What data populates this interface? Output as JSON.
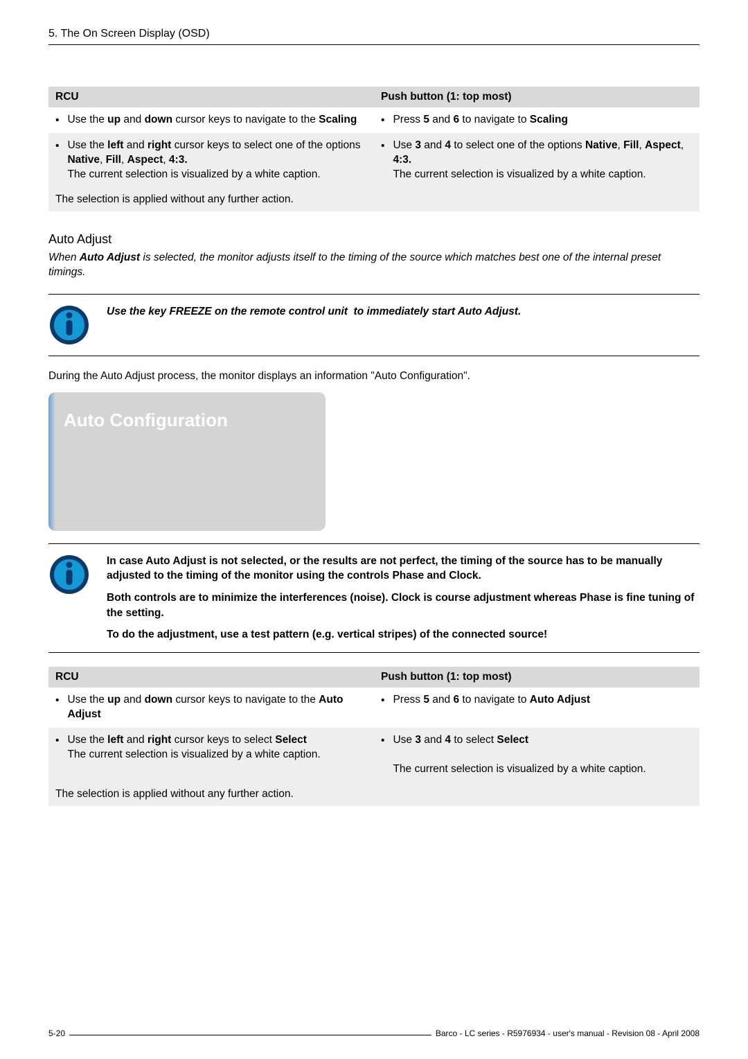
{
  "header": {
    "title": "5. The On Screen Display (OSD)"
  },
  "table1": {
    "head": {
      "rcu": "RCU",
      "push": "Push button (1: top most)"
    },
    "rows": [
      {
        "rcu_html": "Use the <b>up</b> and <b>down</b> cursor keys to navigate to the <b>Scaling</b>",
        "push_html": "Press <b>5</b> and <b>6</b> to navigate to <b>Scaling</b>"
      },
      {
        "rcu_html": "Use the <b>left</b> and <b>right</b> cursor keys to select one of the options <b>Native</b>, <b>Fill</b>, <b>Aspect</b>, <b>4:3.</b><br>The current selection is visualized by a white caption.",
        "push_html": "Use <b>3</b> and <b>4</b> to select one of the options <b>Native</b>, <b>Fill</b>, <b>Aspect</b>, <b>4:3.</b><br>The current selection is visualized by a white caption."
      }
    ],
    "applied": "The selection is applied without any further action."
  },
  "section": {
    "title": "Auto Adjust",
    "intro_html": "When <b>Auto Adjust</b> is selected, the monitor adjusts itself to the timing of the source which matches best one of the internal preset timings."
  },
  "info1": {
    "text_html": "<b><i>Use the key FREEZE on the remote control unit &nbsp;to immediately start Auto Adjust.</i></b>"
  },
  "plain": {
    "during": "During the Auto Adjust process, the monitor displays an information \"Auto Configuration\"."
  },
  "auto_config": {
    "label": "Auto Configuration"
  },
  "info2": {
    "p1": "In case Auto Adjust is not selected, or the results are not perfect, the timing of the source has to be manually adjusted to the timing of the monitor using the controls Phase and Clock.",
    "p2": "Both controls are to minimize the interferences (noise). Clock is course adjustment whereas Phase is fine tuning of the setting.",
    "p3": "To do the adjustment, use a test pattern (e.g. vertical stripes) of the connected source!"
  },
  "table2": {
    "head": {
      "rcu": "RCU",
      "push": "Push button (1: top most)"
    },
    "rows": [
      {
        "rcu_html": "Use the <b>up</b> and <b>down</b> cursor keys to navigate to the <b>Auto Adjust</b>",
        "push_html": "Press <b>5</b> and <b>6</b> to navigate to <b>Auto Adjust</b>"
      },
      {
        "rcu_html": "Use the <b>left</b> and <b>right</b> cursor keys to select <b>Select</b><br>The current selection is visualized by a white caption.",
        "push_html": "Use <b>3</b> and <b>4</b> to select <b>Select</b><br><br>The current selection is visualized by a white caption."
      }
    ],
    "applied": "The selection is applied without any further action."
  },
  "footer": {
    "page": "5-20",
    "text": "Barco - LC series - R5976934 - user's manual - Revision 08 - April 2008"
  }
}
